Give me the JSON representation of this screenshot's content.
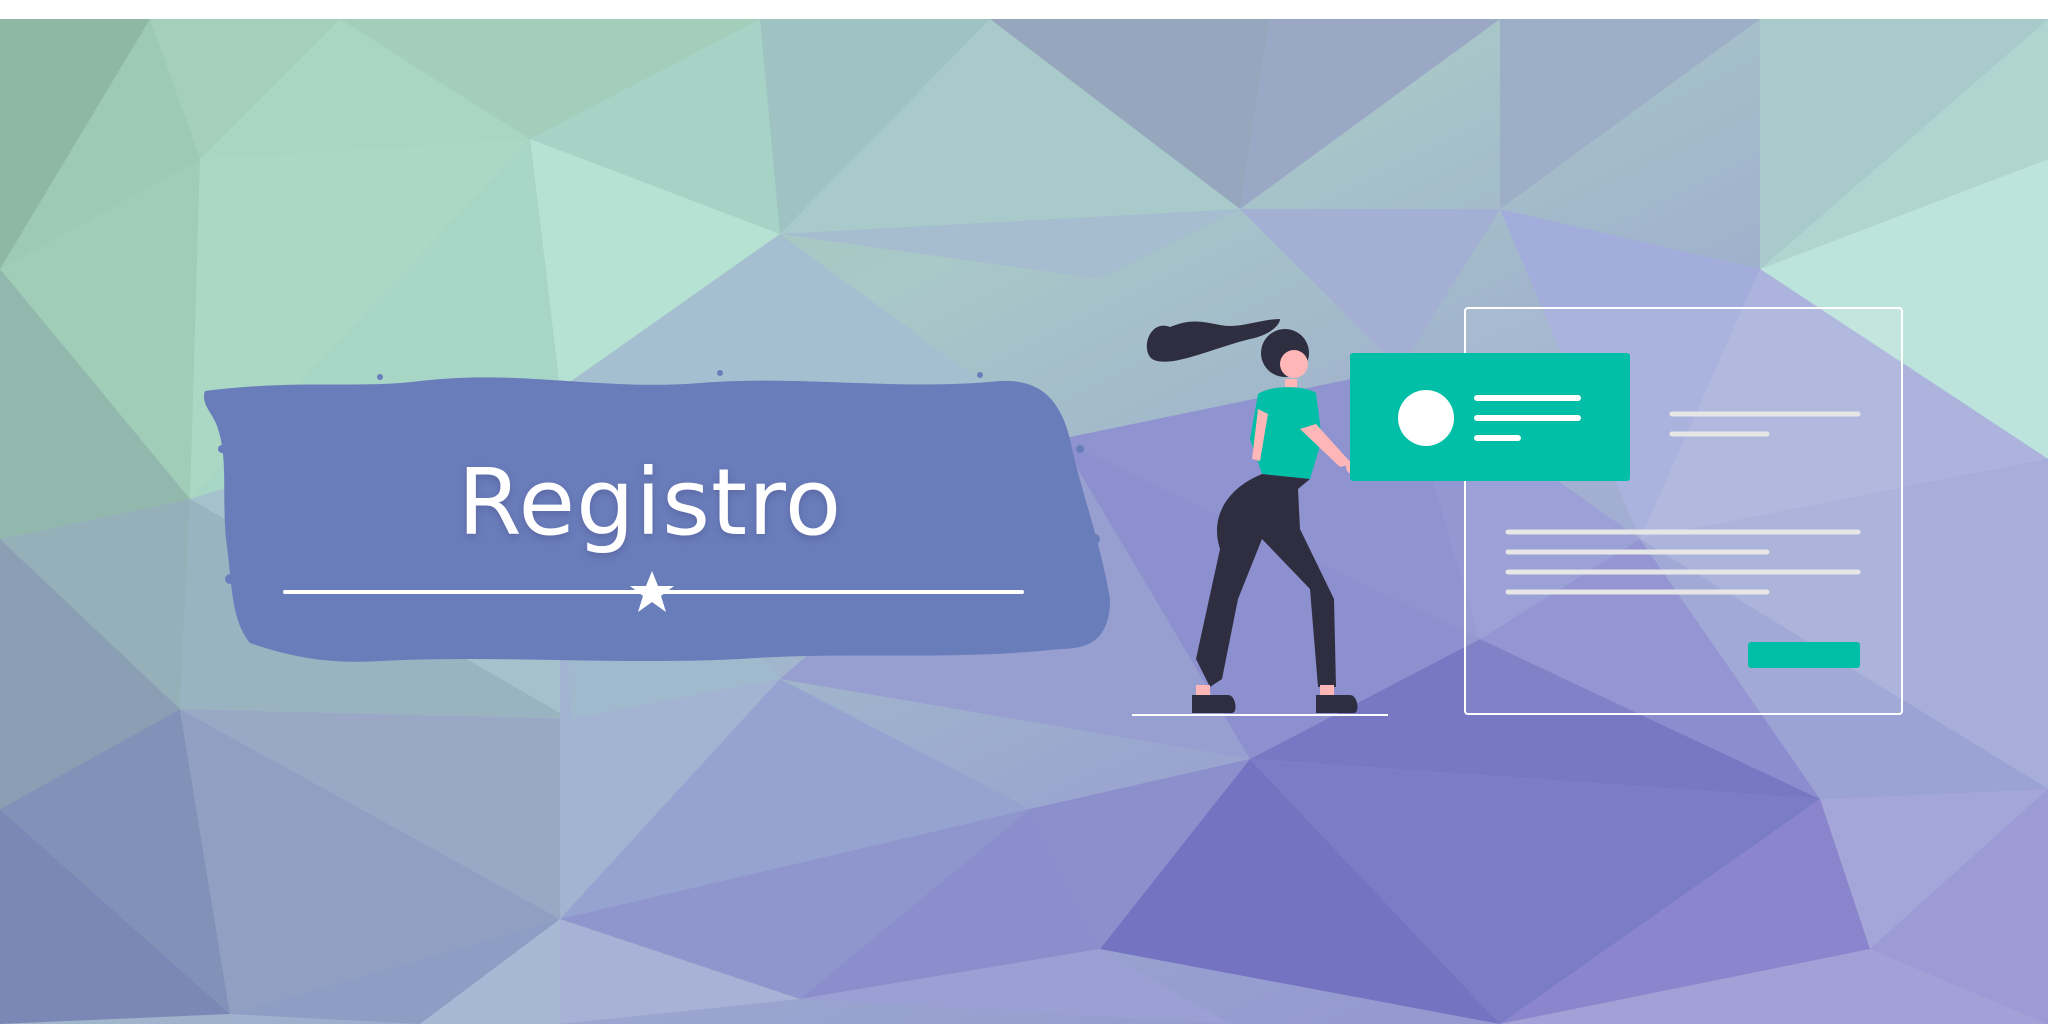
{
  "banner": {
    "title": "Registro"
  },
  "colors": {
    "brush": "#6a7dbb",
    "accent": "#00bfa6",
    "line": "#ffffff",
    "hair": "#2f2e41",
    "skin": "#ffb6b6"
  }
}
